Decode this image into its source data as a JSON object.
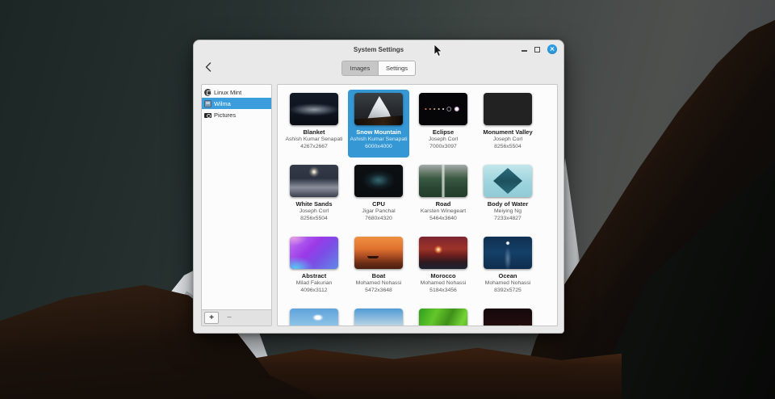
{
  "window": {
    "title": "System Settings",
    "tabs": [
      {
        "label": "Images",
        "active": true
      },
      {
        "label": "Settings",
        "active": false
      }
    ]
  },
  "sidebar": {
    "items": [
      {
        "label": "Linux Mint",
        "icon": "linuxmint-logo-icon",
        "selected": false
      },
      {
        "label": "Wilma",
        "icon": "screen-icon",
        "selected": true
      },
      {
        "label": "Pictures",
        "icon": "camera-icon",
        "selected": false
      }
    ],
    "add_label": "+",
    "remove_label": "−"
  },
  "gallery": {
    "items": [
      {
        "name": "Blanket",
        "author": "Ashish Kumar Senapati",
        "resolution": "4267x2667",
        "thumb": "blanket",
        "selected": false
      },
      {
        "name": "Snow Mountain",
        "author": "Ashish Kumar Senapati",
        "resolution": "6000x4000",
        "thumb": "snow-mountain",
        "selected": true
      },
      {
        "name": "Eclipse",
        "author": "Joseph Corl",
        "resolution": "7000x3097",
        "thumb": "eclipse",
        "selected": false
      },
      {
        "name": "Monument Valley",
        "author": "Joseph Corl",
        "resolution": "8256x5504",
        "thumb": "monument-valley",
        "selected": false
      },
      {
        "name": "White Sands",
        "author": "Joseph Corl",
        "resolution": "8256x5504",
        "thumb": "white-sands",
        "selected": false
      },
      {
        "name": "CPU",
        "author": "Jigar Panchal",
        "resolution": "7680x4320",
        "thumb": "cpu",
        "selected": false
      },
      {
        "name": "Road",
        "author": "Karsten Winegeart",
        "resolution": "5464x3640",
        "thumb": "road",
        "selected": false
      },
      {
        "name": "Body of Water",
        "author": "Meiying Ng",
        "resolution": "7233x4827",
        "thumb": "body-of-water",
        "selected": false
      },
      {
        "name": "Abstract",
        "author": "Milad Fakurian",
        "resolution": "4096x3112",
        "thumb": "abstract",
        "selected": false
      },
      {
        "name": "Boat",
        "author": "Mohamed Nohassi",
        "resolution": "5472x3648",
        "thumb": "boat",
        "selected": false
      },
      {
        "name": "Morocco",
        "author": "Mohamed Nohassi",
        "resolution": "5184x3456",
        "thumb": "morocco",
        "selected": false
      },
      {
        "name": "Ocean",
        "author": "Mohamed Nohassi",
        "resolution": "8392x5725",
        "thumb": "ocean",
        "selected": false
      },
      {
        "name": "",
        "author": "",
        "resolution": "",
        "thumb": "mountains-cloud",
        "selected": false
      },
      {
        "name": "",
        "author": "",
        "resolution": "",
        "thumb": "mountains",
        "selected": false
      },
      {
        "name": "",
        "author": "",
        "resolution": "",
        "thumb": "green-leaf",
        "selected": false
      },
      {
        "name": "",
        "author": "",
        "resolution": "",
        "thumb": "dark-sunset",
        "selected": false
      }
    ]
  },
  "colors": {
    "accent": "#3598d4",
    "close_button": "#2d9ce2",
    "window_chrome": "#e9e9e9"
  }
}
